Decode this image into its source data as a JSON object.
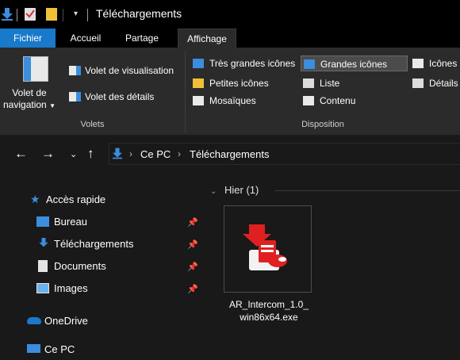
{
  "window": {
    "title": "Téléchargements"
  },
  "ribbon": {
    "tabs": [
      "Fichier",
      "Accueil",
      "Partage",
      "Affichage"
    ],
    "active_tab": "Affichage",
    "panes": {
      "nav_pane_label": "Volet de navigation",
      "preview_pane": "Volet de visualisation",
      "details_pane": "Volet des détails",
      "group_label": "Volets"
    },
    "layout": {
      "extra_large_icons": "Très grandes icônes",
      "large_icons": "Grandes icônes",
      "medium_icons": "Icônes",
      "small_icons": "Petites icônes",
      "list": "Liste",
      "details": "Détails",
      "tiles": "Mosaïques",
      "content": "Contenu",
      "selected": "Grandes icônes",
      "group_label": "Disposition"
    }
  },
  "address": {
    "crumbs": [
      "Ce PC",
      "Téléchargements"
    ]
  },
  "nav": {
    "quick_access": "Accès rapide",
    "items": [
      "Bureau",
      "Téléchargements",
      "Documents",
      "Images"
    ],
    "onedrive": "OneDrive",
    "this_pc": "Ce PC"
  },
  "content": {
    "group_header": "Hier (1)",
    "files": [
      {
        "name": "AR_Intercom_1.0_win86x64.exe",
        "name_line1": "AR_Intercom_1.0_",
        "name_line2": "win86x64.exe"
      }
    ]
  },
  "colors": {
    "accent": "#1979ca",
    "background": "#191919",
    "ribbon": "#2b2b2b",
    "folder": "#f2c038",
    "download_arrow": "#3b8ede",
    "installer_red": "#e02020"
  }
}
